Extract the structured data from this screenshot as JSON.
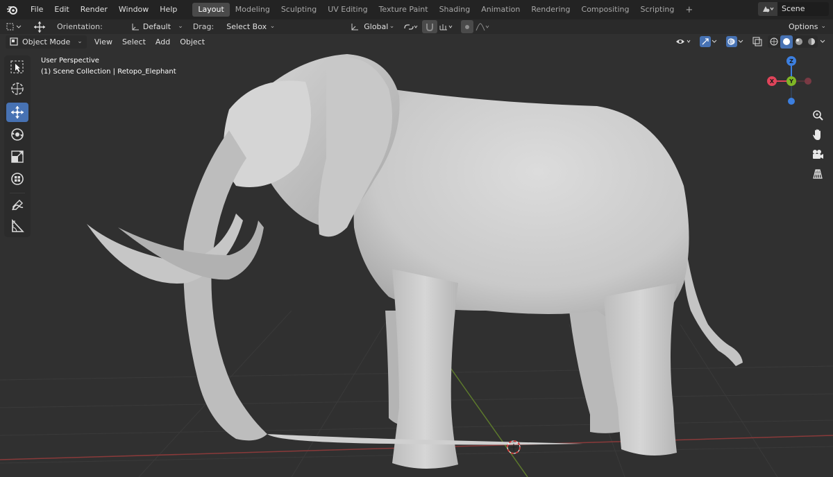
{
  "topbar": {
    "menus": [
      "File",
      "Edit",
      "Render",
      "Window",
      "Help"
    ],
    "workspaces": [
      "Layout",
      "Modeling",
      "Sculpting",
      "UV Editing",
      "Texture Paint",
      "Shading",
      "Animation",
      "Rendering",
      "Compositing",
      "Scripting"
    ],
    "active_workspace": "Layout",
    "add_tab": "+",
    "scene_name": "Scene"
  },
  "toolheader": {
    "orientation_label": "Orientation:",
    "orientation_value": "Default",
    "drag_label": "Drag:",
    "drag_value": "Select Box",
    "transform_orientation": "Global",
    "options_label": "Options"
  },
  "viewport_header": {
    "mode": "Object Mode",
    "menus": [
      "View",
      "Select",
      "Add",
      "Object"
    ]
  },
  "viewport_info": {
    "perspective": "User Perspective",
    "collection": "(1) Scene Collection | Retopo_Elephant"
  },
  "gizmo": {
    "x_label": "X",
    "y_label": "Y",
    "z_label": "Z",
    "x_color": "#e0445a",
    "y_color": "#7fb626",
    "z_color": "#3c7fe0"
  },
  "colors": {
    "accent": "#4772b3",
    "background": "#303030",
    "mesh": "#d0d0d0"
  },
  "icons": [
    "blender-logo-icon",
    "select-box-icon",
    "cursor-icon",
    "move-icon",
    "rotate-icon",
    "scale-icon",
    "transform-icon",
    "annotate-icon",
    "measure-icon",
    "zoom-icon",
    "hand-icon",
    "camera-icon",
    "grid-icon"
  ]
}
